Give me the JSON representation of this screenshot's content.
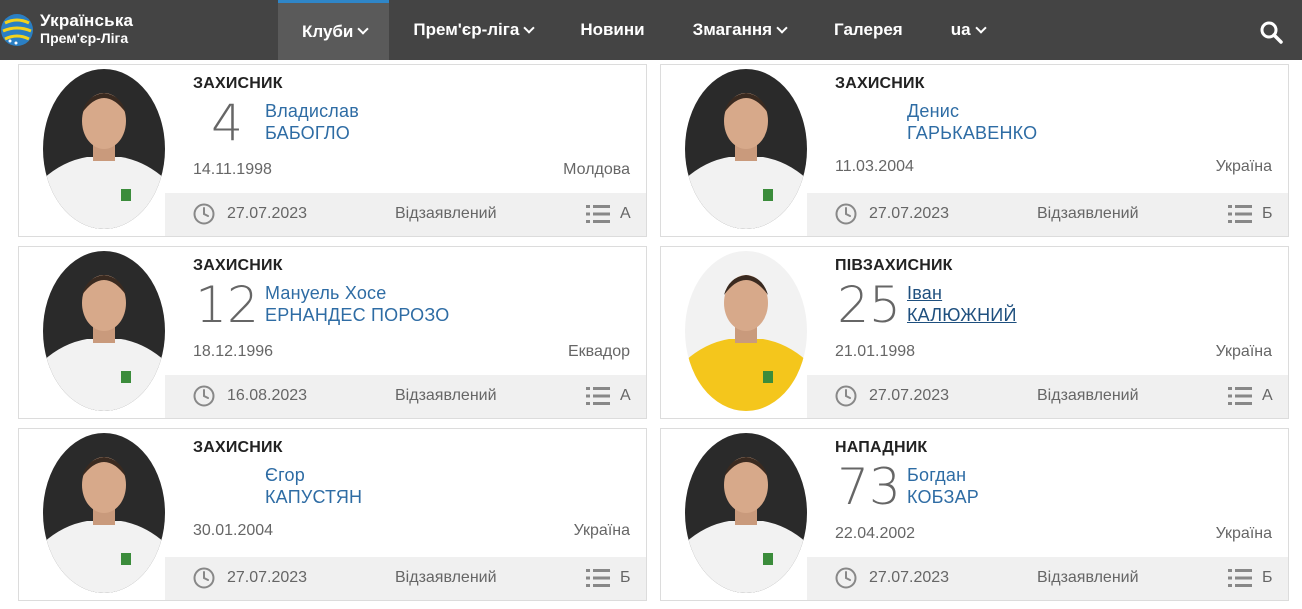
{
  "logo": {
    "line1": "Українська",
    "line2": "Прем'єр-Ліга"
  },
  "menu": [
    {
      "label": "Клуби",
      "dropdown": true,
      "active": true
    },
    {
      "label": "Прем'єр-ліга",
      "dropdown": true
    },
    {
      "label": "Новини",
      "dropdown": false
    },
    {
      "label": "Змагання",
      "dropdown": true
    },
    {
      "label": "Галерея",
      "dropdown": false
    },
    {
      "label": "ua",
      "dropdown": true
    }
  ],
  "players": [
    {
      "position": "ЗАХИСНИК",
      "number": "4",
      "first_name": "Владислав",
      "last_name": "БАБОГЛО",
      "birth_date": "14.11.1998",
      "country": "Молдова",
      "registered": "27.07.2023",
      "status": "Відзаявлений",
      "list": "А",
      "kit": "white"
    },
    {
      "position": "ЗАХИСНИК",
      "number": "",
      "first_name": "Денис",
      "last_name": "ГАРЬКАВЕНКО",
      "birth_date": "11.03.2004",
      "country": "Україна",
      "registered": "27.07.2023",
      "status": "Відзаявлений",
      "list": "Б",
      "kit": "white"
    },
    {
      "position": "ЗАХИСНИК",
      "number": "12",
      "first_name": "Мануель Хосе",
      "last_name": "ЕРНАНДЕС ПОРОЗО",
      "birth_date": "18.12.1996",
      "country": "Еквадор",
      "registered": "16.08.2023",
      "status": "Відзаявлений",
      "list": "А",
      "kit": "white"
    },
    {
      "position": "ПІВЗАХИСНИК",
      "number": "25",
      "first_name": "Іван",
      "last_name": "КАЛЮЖНИЙ",
      "birth_date": "21.01.1998",
      "country": "Україна",
      "registered": "27.07.2023",
      "status": "Відзаявлений",
      "list": "А",
      "kit": "yellow"
    },
    {
      "position": "ЗАХИСНИК",
      "number": "",
      "first_name": "Єгор",
      "last_name": "КАПУСТЯН",
      "birth_date": "30.01.2004",
      "country": "Україна",
      "registered": "27.07.2023",
      "status": "Відзаявлений",
      "list": "Б",
      "kit": "white"
    },
    {
      "position": "НАПАДНИК",
      "number": "73",
      "first_name": "Богдан",
      "last_name": "КОБЗАР",
      "birth_date": "22.04.2002",
      "country": "Україна",
      "registered": "27.07.2023",
      "status": "Відзаявлений",
      "list": "Б",
      "kit": "white"
    }
  ],
  "colors": {
    "nav_bg": "#444444",
    "accent": "#2f86c8",
    "link": "#2e6ca4"
  },
  "icons": {
    "search": "search-icon",
    "clock": "clock-icon",
    "list": "list-icon"
  }
}
